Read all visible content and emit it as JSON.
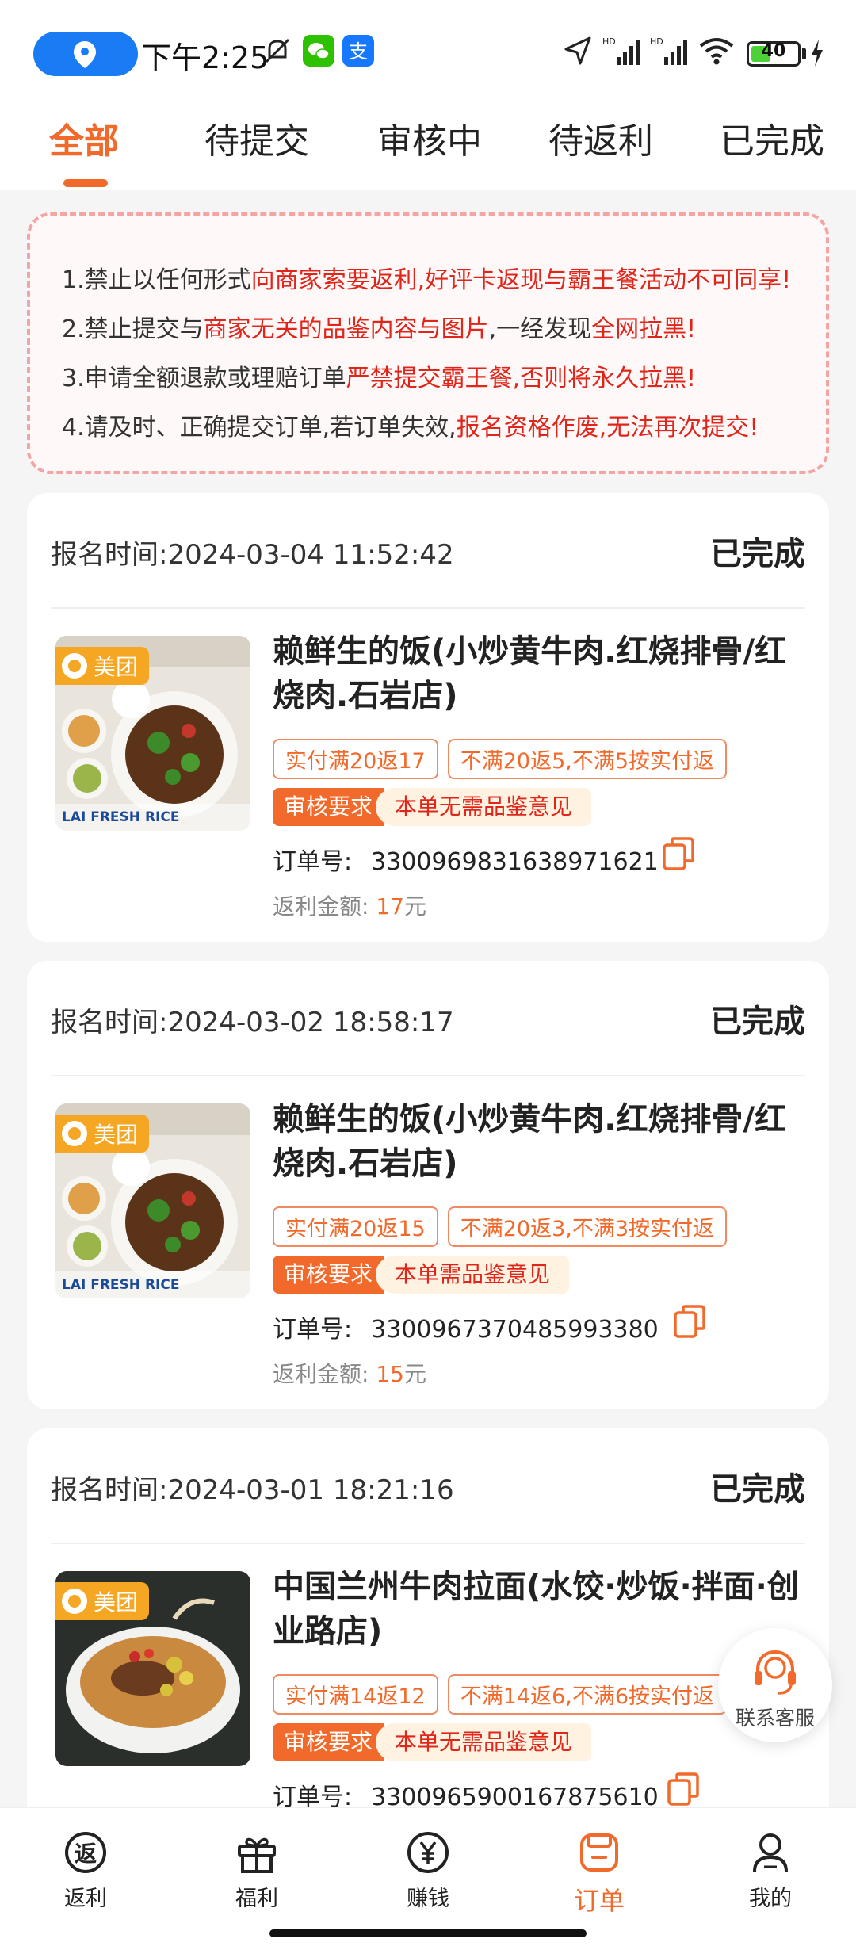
{
  "status_bar": {
    "time": "下午2:25",
    "battery": "40"
  },
  "tabs": [
    "全部",
    "待提交",
    "审核中",
    "待返利",
    "已完成"
  ],
  "notice": [
    {
      "parts": [
        {
          "t": "1.禁止以任何形式",
          "red": false
        },
        {
          "t": "向商家索要返利,好评卡返现与霸王餐活动不可同享!",
          "red": true
        }
      ]
    },
    {
      "parts": [
        {
          "t": "2.禁止提交与",
          "red": false
        },
        {
          "t": "商家无关的品鉴内容与图片",
          "red": true
        },
        {
          "t": ",一经发现",
          "red": false
        },
        {
          "t": "全网拉黑!",
          "red": true
        }
      ]
    },
    {
      "parts": [
        {
          "t": "3.申请全额退款或理赔订单",
          "red": false
        },
        {
          "t": "严禁提交霸王餐,否则将永久拉黑!",
          "red": true
        }
      ]
    },
    {
      "parts": [
        {
          "t": "4.请及时、正确提交订单,若订单失效,",
          "red": false
        },
        {
          "t": "报名资格作废,无法再次提交!",
          "red": true
        }
      ]
    }
  ],
  "labels": {
    "reg_time": "报名时间:",
    "order_no": "订单号:",
    "rebate": "返利金额:",
    "review_req": "审核要求",
    "currency": "元",
    "platform": "美团"
  },
  "orders": [
    {
      "reg_time": "2024-03-04 11:52:42",
      "status": "已完成",
      "store_name": "赖鲜生的饭(小炒黄牛肉.红烧排骨/红烧肉.石岩店)",
      "tags": [
        "实付满20返17",
        "不满20返5,不满5按实付返"
      ],
      "review": "本单无需品鉴意见",
      "order_no": "3300969831638971621",
      "rebate": "17"
    },
    {
      "reg_time": "2024-03-02 18:58:17",
      "status": "已完成",
      "store_name": "赖鲜生的饭(小炒黄牛肉.红烧排骨/红烧肉.石岩店)",
      "tags": [
        "实付满20返15",
        "不满20返3,不满3按实付返"
      ],
      "review": "本单需品鉴意见",
      "order_no": "3300967370485993380",
      "rebate": "15"
    },
    {
      "reg_time": "2024-03-01 18:21:16",
      "status": "已完成",
      "store_name": "中国兰州牛肉拉面(水饺·炒饭·拌面·创业路店)",
      "tags": [
        "实付满14返12",
        "不满14返6,不满6按实付返"
      ],
      "review": "本单无需品鉴意见",
      "order_no": "3300965900167875610",
      "rebate": ""
    }
  ],
  "service_label": "联系客服",
  "bottom_nav": [
    {
      "label": "返利",
      "icon": "rebate-icon"
    },
    {
      "label": "福利",
      "icon": "gift-icon"
    },
    {
      "label": "赚钱",
      "icon": "yuan-icon"
    },
    {
      "label": "订单",
      "icon": "order-icon"
    },
    {
      "label": "我的",
      "icon": "user-icon"
    }
  ],
  "colors": {
    "accent": "#f26a2b",
    "warning_red": "#e0261b",
    "meituan": "#f5a623"
  }
}
